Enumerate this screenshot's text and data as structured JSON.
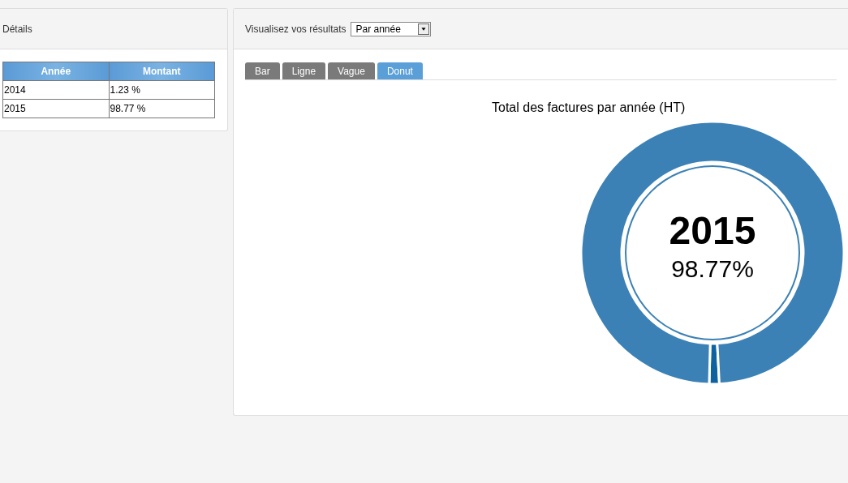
{
  "details": {
    "title": "Détails",
    "table": {
      "columns": [
        "Année",
        "Montant"
      ],
      "rows": [
        [
          "2014",
          "1.23 %"
        ],
        [
          "2015",
          "98.77 %"
        ]
      ]
    }
  },
  "results": {
    "label": "Visualisez vos résultats",
    "select": {
      "value": "Par année"
    },
    "tabs": [
      {
        "label": "Bar",
        "selected": false
      },
      {
        "label": "Ligne",
        "selected": false
      },
      {
        "label": "Vague",
        "selected": false
      },
      {
        "label": "Donut",
        "selected": true
      }
    ],
    "chart": {
      "center_title": "2015",
      "center_value": "98.77%",
      "chart_data": {
        "type": "donut",
        "title": "Total des factures par année (HT)",
        "series": [
          {
            "colors": [
              "#0e62a0",
              "#3b81b5"
            ],
            "values": [
              1.23,
              98.77
            ]
          }
        ]
      }
    }
  }
}
